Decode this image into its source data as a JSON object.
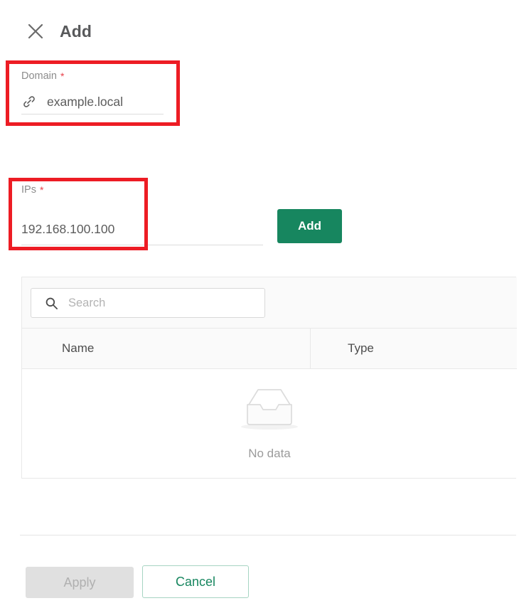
{
  "dialog": {
    "title": "Add",
    "close_icon": "close-icon"
  },
  "fields": {
    "domain": {
      "label": "Domain",
      "required_marker": "*",
      "icon": "link-icon",
      "value": "example.local"
    },
    "ips": {
      "label": "IPs",
      "required_marker": "*",
      "value": "192.168.100.100"
    }
  },
  "actions": {
    "add_label": "Add",
    "apply_label": "Apply",
    "cancel_label": "Cancel"
  },
  "table": {
    "search": {
      "placeholder": "Search",
      "value": "",
      "icon": "search-icon"
    },
    "columns": [
      {
        "label": "Name"
      },
      {
        "label": "Type"
      }
    ],
    "rows": [],
    "empty_state": {
      "icon": "inbox-icon",
      "text": "No data"
    }
  },
  "colors": {
    "accent_green": "#17865f",
    "required_red": "#e8414a",
    "annotation_red": "#ed1c24",
    "disabled_gray": "#e0e0e0"
  },
  "annotations": [
    {
      "name": "domain-highlight"
    },
    {
      "name": "ips-highlight"
    }
  ]
}
